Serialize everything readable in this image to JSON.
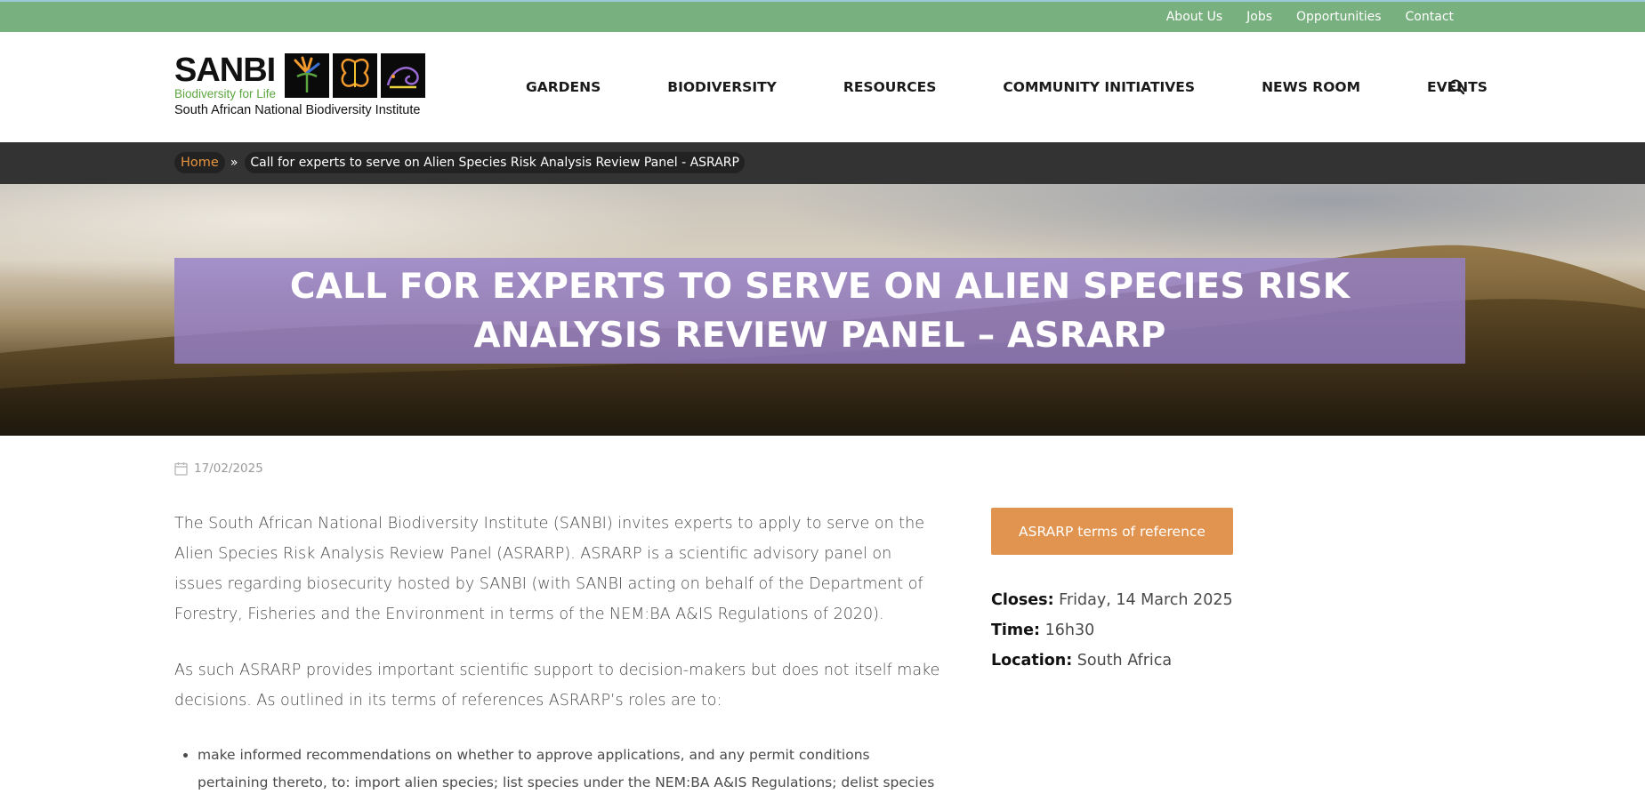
{
  "topbar": {
    "links": [
      "About Us",
      "Jobs",
      "Opportunities",
      "Contact"
    ]
  },
  "logo": {
    "name": "SANBI",
    "tagline": "Biodiversity for Life",
    "institute": "South African National Biodiversity Institute"
  },
  "nav": {
    "items": [
      "GARDENS",
      "BIODIVERSITY",
      "RESOURCES",
      "COMMUNITY INITIATIVES",
      "NEWS ROOM",
      "EVENTS"
    ]
  },
  "breadcrumb": {
    "home": "Home",
    "separator": "»",
    "current": "Call for experts to serve on Alien Species Risk Analysis Review Panel - ASRARP"
  },
  "hero": {
    "title": "CALL FOR EXPERTS TO SERVE ON ALIEN SPECIES RISK ANALYSIS REVIEW PANEL – ASRARP"
  },
  "post": {
    "date": "17/02/2025",
    "paragraphs": [
      "The South African National Biodiversity Institute (SANBI) invites experts to apply to serve on the Alien Species Risk Analysis Review Panel (ASRARP). ASRARP is a scientific advisory panel on issues regarding biosecurity hosted by SANBI (with SANBI acting on behalf of the Department of Forestry, Fisheries and the Environment in terms of the NEM:BA A&IS Regulations of 2020).",
      "As such ASRARP provides important scientific support to decision-makers but does not itself make decisions. As outlined in its terms of references ASRARP’s roles are to:"
    ],
    "bullets": [
      "make informed recommendations on whether to approve applications, and any permit conditions pertaining thereto, to: import alien species; list species under the NEM:BA A&IS Regulations; delist species under the"
    ]
  },
  "sidebar": {
    "button": "ASRARP terms of reference",
    "closes_label": "Closes:",
    "closes_value": "Friday, 14 March 2025",
    "time_label": "Time:",
    "time_value": "16h30",
    "location_label": "Location:",
    "location_value": "South Africa"
  },
  "colors": {
    "topbar": "#79b07f",
    "crumbbar": "#333333",
    "accent_orange": "#e0944f",
    "title_box": "#9680c8"
  }
}
